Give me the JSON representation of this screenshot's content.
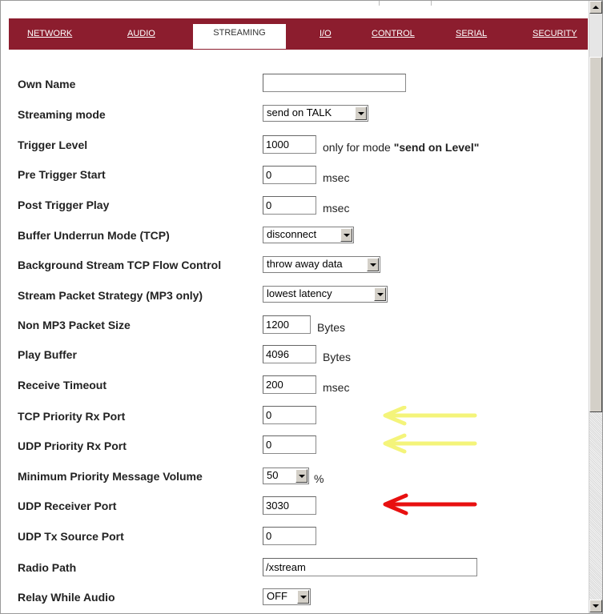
{
  "tabs": [
    {
      "label": "NETWORK"
    },
    {
      "label": "AUDIO"
    },
    {
      "label": "STREAMING",
      "active": true
    },
    {
      "label": "I/O"
    },
    {
      "label": "CONTROL"
    },
    {
      "label": "SERIAL"
    },
    {
      "label": "SECURITY"
    }
  ],
  "colors": {
    "tabbar": "#8c1d2e",
    "yellow_arrow": "#f4f47a",
    "red_arrow": "#e81010"
  },
  "settings": {
    "own_name": {
      "label": "Own Name",
      "value": ""
    },
    "streaming_mode": {
      "label": "Streaming mode",
      "value": "send on TALK"
    },
    "trigger_level": {
      "label": "Trigger Level",
      "value": "1000",
      "note_prefix": "only for mode ",
      "note_emph": "\"send on Level\""
    },
    "pre_trigger_start": {
      "label": "Pre Trigger Start",
      "value": "0",
      "unit": "msec"
    },
    "post_trigger_play": {
      "label": "Post Trigger Play",
      "value": "0",
      "unit": "msec"
    },
    "buffer_underrun_mode": {
      "label": "Buffer Underrun Mode (TCP)",
      "value": "disconnect"
    },
    "bg_stream_flow_control": {
      "label": "Background Stream TCP Flow Control",
      "value": "throw away data"
    },
    "stream_packet_strategy": {
      "label": "Stream Packet Strategy (MP3 only)",
      "value": "lowest latency"
    },
    "non_mp3_packet_size": {
      "label": "Non MP3 Packet Size",
      "value": "1200",
      "unit": "Bytes"
    },
    "play_buffer": {
      "label": "Play Buffer",
      "value": "4096",
      "unit": "Bytes"
    },
    "receive_timeout": {
      "label": "Receive Timeout",
      "value": "200",
      "unit": "msec"
    },
    "tcp_priority_rx_port": {
      "label": "TCP Priority Rx Port",
      "value": "0"
    },
    "udp_priority_rx_port": {
      "label": "UDP Priority Rx Port",
      "value": "0"
    },
    "min_priority_msg_volume": {
      "label": "Minimum Priority Message Volume",
      "value": "50",
      "unit": "%"
    },
    "udp_receiver_port": {
      "label": "UDP Receiver Port",
      "value": "3030"
    },
    "udp_tx_source_port": {
      "label": "UDP Tx Source Port",
      "value": "0"
    },
    "radio_path": {
      "label": "Radio Path",
      "value": "/xstream"
    },
    "relay_while_audio": {
      "label": "Relay While Audio",
      "value": "OFF"
    }
  }
}
